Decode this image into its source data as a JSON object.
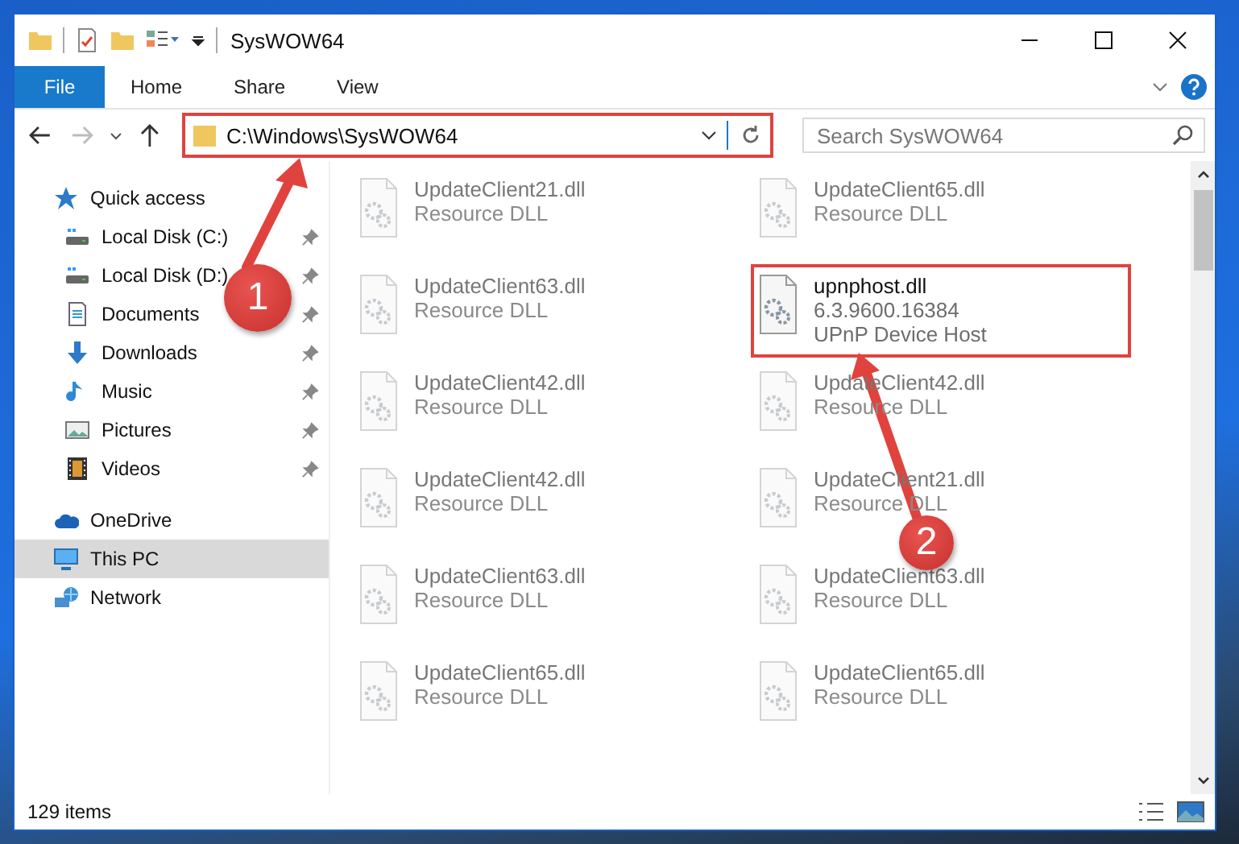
{
  "window": {
    "title": "SysWOW64"
  },
  "ribbon": {
    "tabs": [
      {
        "label": "File",
        "selected": true
      },
      {
        "label": "Home",
        "selected": false
      },
      {
        "label": "Share",
        "selected": false
      },
      {
        "label": "View",
        "selected": false
      }
    ]
  },
  "address": {
    "path": "C:\\Windows\\SysWOW64",
    "highlighted": true
  },
  "search": {
    "placeholder": "Search SysWOW64"
  },
  "sidebar": {
    "items": [
      {
        "label": "Quick access",
        "kind": "star",
        "selected": false,
        "children": [
          {
            "label": "Local Disk (C:)",
            "kind": "drive",
            "pinned": true,
            "selected": false
          },
          {
            "label": "Local Disk (D:)",
            "kind": "drive",
            "pinned": true,
            "selected": false
          },
          {
            "label": "Documents",
            "kind": "documents",
            "pinned": true,
            "selected": false
          },
          {
            "label": "Downloads",
            "kind": "downloads",
            "pinned": true,
            "selected": false
          },
          {
            "label": "Music",
            "kind": "music",
            "pinned": true,
            "selected": false
          },
          {
            "label": "Pictures",
            "kind": "pictures",
            "pinned": true,
            "selected": false
          },
          {
            "label": "Videos",
            "kind": "videos",
            "pinned": true,
            "selected": false
          }
        ]
      },
      {
        "label": "OneDrive",
        "kind": "cloud",
        "selected": false
      },
      {
        "label": "This PC",
        "kind": "computer",
        "selected": true
      },
      {
        "label": "Network",
        "kind": "network",
        "selected": false
      }
    ]
  },
  "files": [
    {
      "name": "UpdateClient21.dll",
      "lines": [
        "Resource DLL"
      ],
      "blurred": true,
      "highlighted": false
    },
    {
      "name": "UpdateClient65.dll",
      "lines": [
        "Resource DLL"
      ],
      "blurred": true,
      "highlighted": false
    },
    {
      "name": "UpdateClient63.dll",
      "lines": [
        "Resource DLL"
      ],
      "blurred": true,
      "highlighted": false
    },
    {
      "name": "upnphost.dll",
      "lines": [
        "6.3.9600.16384",
        "UPnP Device Host"
      ],
      "blurred": false,
      "highlighted": true
    },
    {
      "name": "UpdateClient42.dll",
      "lines": [
        "Resource DLL"
      ],
      "blurred": true,
      "highlighted": false
    },
    {
      "name": "UpdateClient42.dll",
      "lines": [
        "Resource DLL"
      ],
      "blurred": true,
      "highlighted": false
    },
    {
      "name": "UpdateClient42.dll",
      "lines": [
        "Resource DLL"
      ],
      "blurred": true,
      "highlighted": false
    },
    {
      "name": "UpdateClient21.dll",
      "lines": [
        "Resource DLL"
      ],
      "blurred": true,
      "highlighted": false
    },
    {
      "name": "UpdateClient63.dll",
      "lines": [
        "Resource DLL"
      ],
      "blurred": true,
      "highlighted": false
    },
    {
      "name": "UpdateClient63.dll",
      "lines": [
        "Resource DLL"
      ],
      "blurred": true,
      "highlighted": false
    },
    {
      "name": "UpdateClient65.dll",
      "lines": [
        "Resource DLL"
      ],
      "blurred": true,
      "highlighted": false
    },
    {
      "name": "UpdateClient65.dll",
      "lines": [
        "Resource DLL"
      ],
      "blurred": true,
      "highlighted": false
    }
  ],
  "status_bar": {
    "count": "129 items"
  },
  "annotations": [
    {
      "number": "1"
    },
    {
      "number": "2"
    }
  ]
}
